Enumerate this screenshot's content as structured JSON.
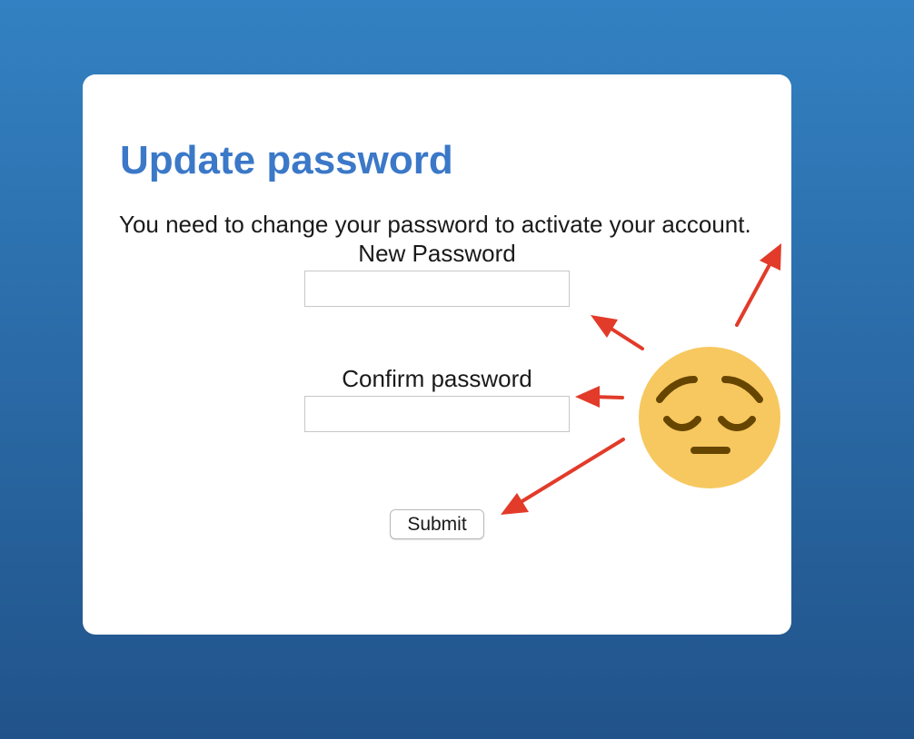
{
  "form": {
    "title": "Update password",
    "instructions": "You need to change your password to activate your account.",
    "new_password_label": "New Password",
    "new_password_value": "",
    "confirm_password_label": "Confirm password",
    "confirm_password_value": "",
    "submit_label": "Submit"
  },
  "annotations": {
    "emoji_icon": "pensive-face-icon",
    "arrow_color": "#e23b2a",
    "emoji_color": "#f6c85f"
  },
  "colors": {
    "title": "#3b78c8",
    "background_top": "#3381c2",
    "background_bottom": "#21538a",
    "card": "#ffffff"
  }
}
